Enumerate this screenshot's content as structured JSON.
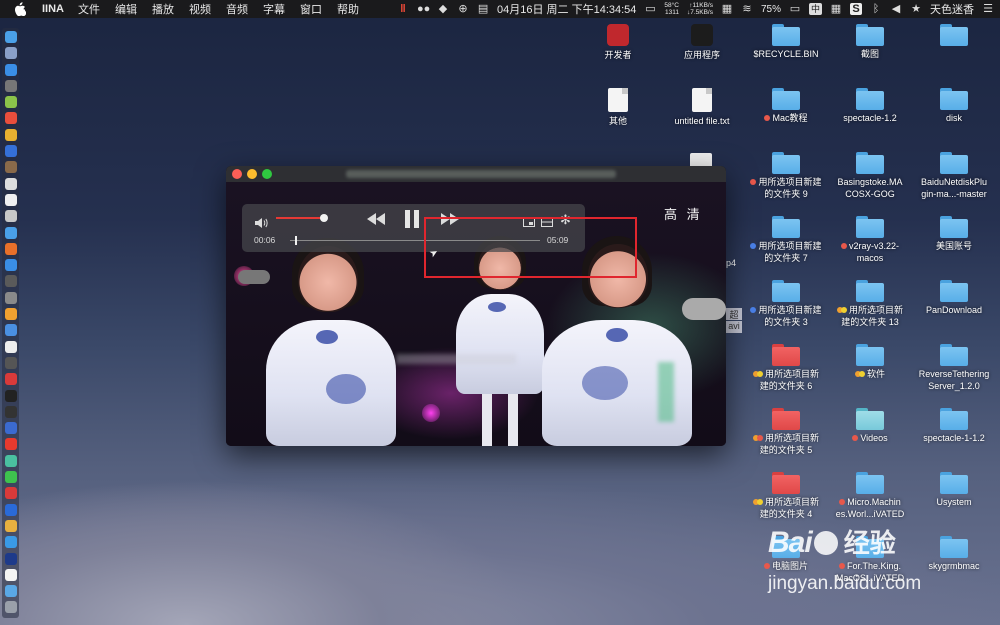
{
  "menubar": {
    "app_name": "IINA",
    "items": [
      "文件",
      "编辑",
      "播放",
      "视频",
      "音频",
      "字幕",
      "窗口",
      "帮助"
    ],
    "datetime": "04月16日 周二 下午14:34:54",
    "temperature": "58°C",
    "fan": "1311",
    "upload": "↑11KB/s",
    "download": "↓7.5KB/s",
    "battery": "75%",
    "input_method": "中",
    "user": "天色迷香"
  },
  "player": {
    "quality_label": "高 清",
    "time_current": "00:06",
    "time_total": "05:09",
    "volume_fraction": 0.95,
    "progress_fraction": 0.02
  },
  "desktop": {
    "items": [
      {
        "label": "开发者",
        "kind": "app",
        "color": "#c0282d"
      },
      {
        "label": "应用程序",
        "kind": "app",
        "color": "#1c1c1c"
      },
      {
        "label": "$RECYCLE.BIN",
        "kind": "folder-blue"
      },
      {
        "label": "截图",
        "kind": "folder-blue"
      },
      {
        "label": "",
        "kind": "folder-blue"
      },
      {
        "label": "其他",
        "kind": "file"
      },
      {
        "label": "untitled file.txt",
        "kind": "file"
      },
      {
        "label": "Mac教程",
        "kind": "folder-blue",
        "tag": "#e8584b"
      },
      {
        "label": "spectacle-1.2",
        "kind": "folder-blue"
      },
      {
        "label": "disk",
        "kind": "folder-blue"
      },
      {
        "label_lines": [
          "用所选项目新建",
          "的文件夹 9"
        ],
        "kind": "folder-blue",
        "tag": "#e8584b"
      },
      {
        "label_lines": [
          "Basingstoke.MA",
          "COSX-GOG"
        ],
        "kind": "folder-blue"
      },
      {
        "label_lines": [
          "BaiduNetdiskPlu",
          "gin-ma...-master"
        ],
        "kind": "folder-blue"
      },
      {
        "label_lines": [
          "用所选项目新建",
          "的文件夹 7"
        ],
        "kind": "folder-blue",
        "tag": "#4a80e8"
      },
      {
        "label_lines": [
          "v2ray-v3.22-",
          "macos"
        ],
        "kind": "folder-blue",
        "tag": "#e8584b"
      },
      {
        "label": "美国账号",
        "kind": "folder-blue"
      },
      {
        "label_lines": [
          "用所选项目新建",
          "的文件夹 3"
        ],
        "kind": "folder-blue",
        "tag": "#4a80e8"
      },
      {
        "label_lines": [
          "用所选项目新",
          "建的文件夹 13"
        ],
        "kind": "folder-blue",
        "tag2": [
          "#f0a030",
          "#f0d030"
        ]
      },
      {
        "label": "PanDownload",
        "kind": "folder-blue"
      },
      {
        "label_lines": [
          "用所选项目新",
          "建的文件夹 6"
        ],
        "kind": "folder-red",
        "tag2": [
          "#f0a030",
          "#f0d030"
        ]
      },
      {
        "label": "软件",
        "kind": "folder-blue",
        "tag2": [
          "#f0a030",
          "#f0d030"
        ]
      },
      {
        "label_lines": [
          "ReverseTethering",
          "Server_1.2.0"
        ],
        "kind": "folder-blue"
      },
      {
        "label_lines": [
          "用所选项目新",
          "建的文件夹 5"
        ],
        "kind": "folder-red",
        "tag2": [
          "#f0a030",
          "#e8584b"
        ]
      },
      {
        "label": "Videos",
        "kind": "folder-teal",
        "tag": "#e8584b"
      },
      {
        "label": "spectacle-1-1.2",
        "kind": "folder-blue"
      },
      {
        "label_lines": [
          "用所选项目新",
          "建的文件夹 4"
        ],
        "kind": "folder-red",
        "tag2": [
          "#f0a030",
          "#f0d030"
        ]
      },
      {
        "label_lines": [
          "Micro.Machin",
          "es.Worl...iVATED"
        ],
        "kind": "folder-blue",
        "tag": "#e8584b"
      },
      {
        "label": "Usystem",
        "kind": "folder-blue"
      },
      {
        "label_lines": [
          "电脑图片"
        ],
        "kind": "folder-blue",
        "tag": "#e8584b"
      },
      {
        "label_lines": [
          "For.The.King.",
          "MacOS...iVATED"
        ],
        "kind": "folder-blue",
        "tag": "#e8584b"
      },
      {
        "label": "skygrmbmac",
        "kind": "folder-blue"
      }
    ],
    "partial_labels": [
      "p4",
      "超",
      "avi"
    ]
  },
  "watermark": {
    "logo": "Bai",
    "logo_tail": "经验",
    "url": "jingyan.baidu.com"
  },
  "colors": {
    "accent_red": "#e53935",
    "highlight_box": "#e0262e"
  }
}
